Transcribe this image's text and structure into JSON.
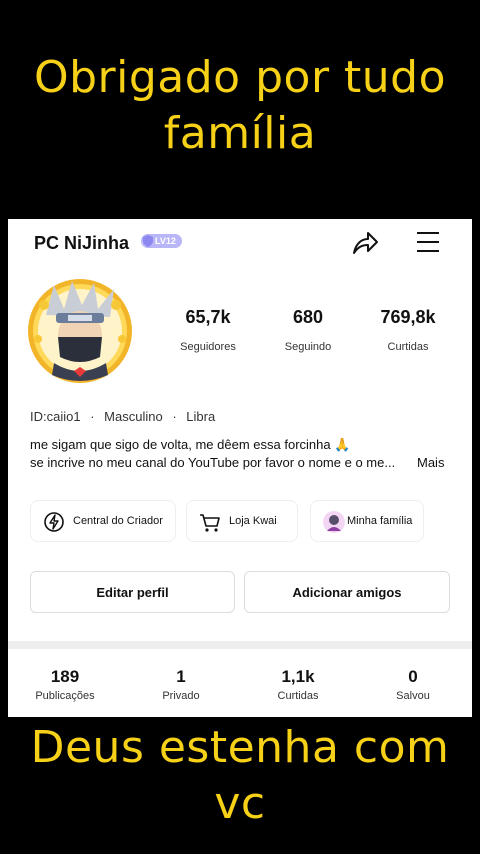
{
  "captions": {
    "top_line1": "Obrigado por tudo",
    "top_line2": "família",
    "bottom_line1": "Deus estenha com",
    "bottom_line2": "vc",
    "color": "#f7d117"
  },
  "profile": {
    "username": "PC NiJinha",
    "level_badge": "LV12",
    "stats": [
      {
        "value": "65,7k",
        "label": "Seguidores"
      },
      {
        "value": "680",
        "label": "Seguindo"
      },
      {
        "value": "769,8k",
        "label": "Curtidas"
      }
    ],
    "id": "ID:caiio1",
    "gender": "Masculino",
    "sign": "Libra",
    "separator": "·",
    "bio_line1": "me sigam que sigo de volta, me dêem essa forcinha 🙏",
    "bio_line2": "se incrive no meu canal do YouTube por favor o nome e o me...",
    "more_label": "Mais"
  },
  "chips": [
    {
      "label": "Central do Criador",
      "icon": "creator-center-icon"
    },
    {
      "label": "Loja Kwai",
      "icon": "shopping-cart-icon"
    },
    {
      "label": "Minha família",
      "icon": "family-avatar-icon"
    }
  ],
  "buttons": {
    "edit": "Editar perfil",
    "add_friends": "Adicionar amigos"
  },
  "content_stats": [
    {
      "value": "189",
      "label": "Publicações"
    },
    {
      "value": "1",
      "label": "Privado"
    },
    {
      "value": "1,1k",
      "label": "Curtidas"
    },
    {
      "value": "0",
      "label": "Salvou"
    }
  ],
  "icons": {
    "share": "share-icon",
    "menu": "menu-icon",
    "badge": "level-shield-icon"
  }
}
